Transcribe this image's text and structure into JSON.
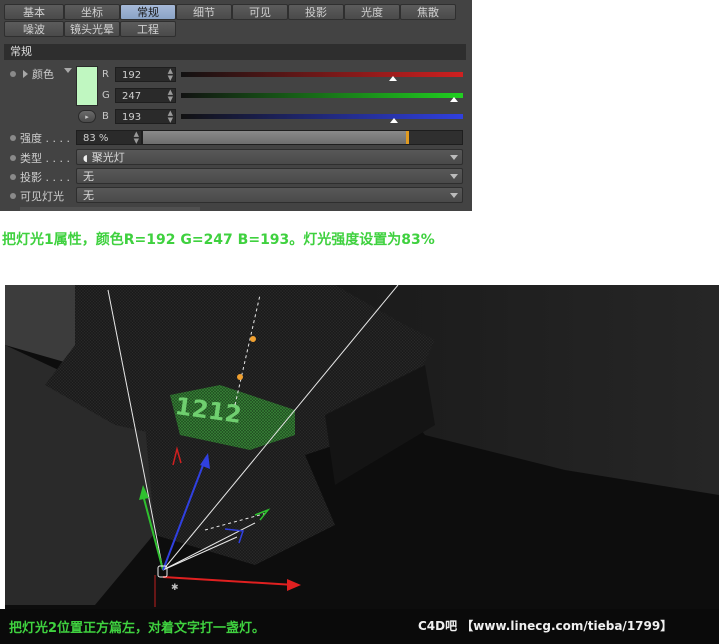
{
  "tabs_row1": [
    "基本",
    "坐标",
    "常规",
    "细节",
    "可见",
    "投影",
    "光度",
    "焦散"
  ],
  "tabs_row2": [
    "噪波",
    "镜头光晕",
    "工程"
  ],
  "active_tab": "常规",
  "section_title": "常规",
  "color": {
    "label": "颜色",
    "swatch": "#c0f7c1",
    "channels": [
      {
        "name": "R",
        "value": "192",
        "fraction": 0.753,
        "color": "#d02020"
      },
      {
        "name": "G",
        "value": "247",
        "fraction": 0.969,
        "color": "#20d020"
      },
      {
        "name": "B",
        "value": "193",
        "fraction": 0.757,
        "color": "#3040e0"
      }
    ]
  },
  "intensity": {
    "label": "强度 . . . .",
    "value": "83 %",
    "fraction": 0.83
  },
  "type": {
    "label": "类型 . . . .",
    "value": "聚光灯"
  },
  "shadow": {
    "label": "投影 . . . .",
    "value": "无"
  },
  "visible_light": {
    "label": "可见灯光",
    "value": "无"
  },
  "caption_top": "把灯光1属性，颜色R=192 G=247 B=193。灯光强度设置为83%",
  "caption_bottom": "把灯光2位置正方篇左，对着文字打一盏灯。",
  "watermark": "C4D吧 【www.linecg.com/tieba/1799】",
  "accent_green": "#3fd13f"
}
